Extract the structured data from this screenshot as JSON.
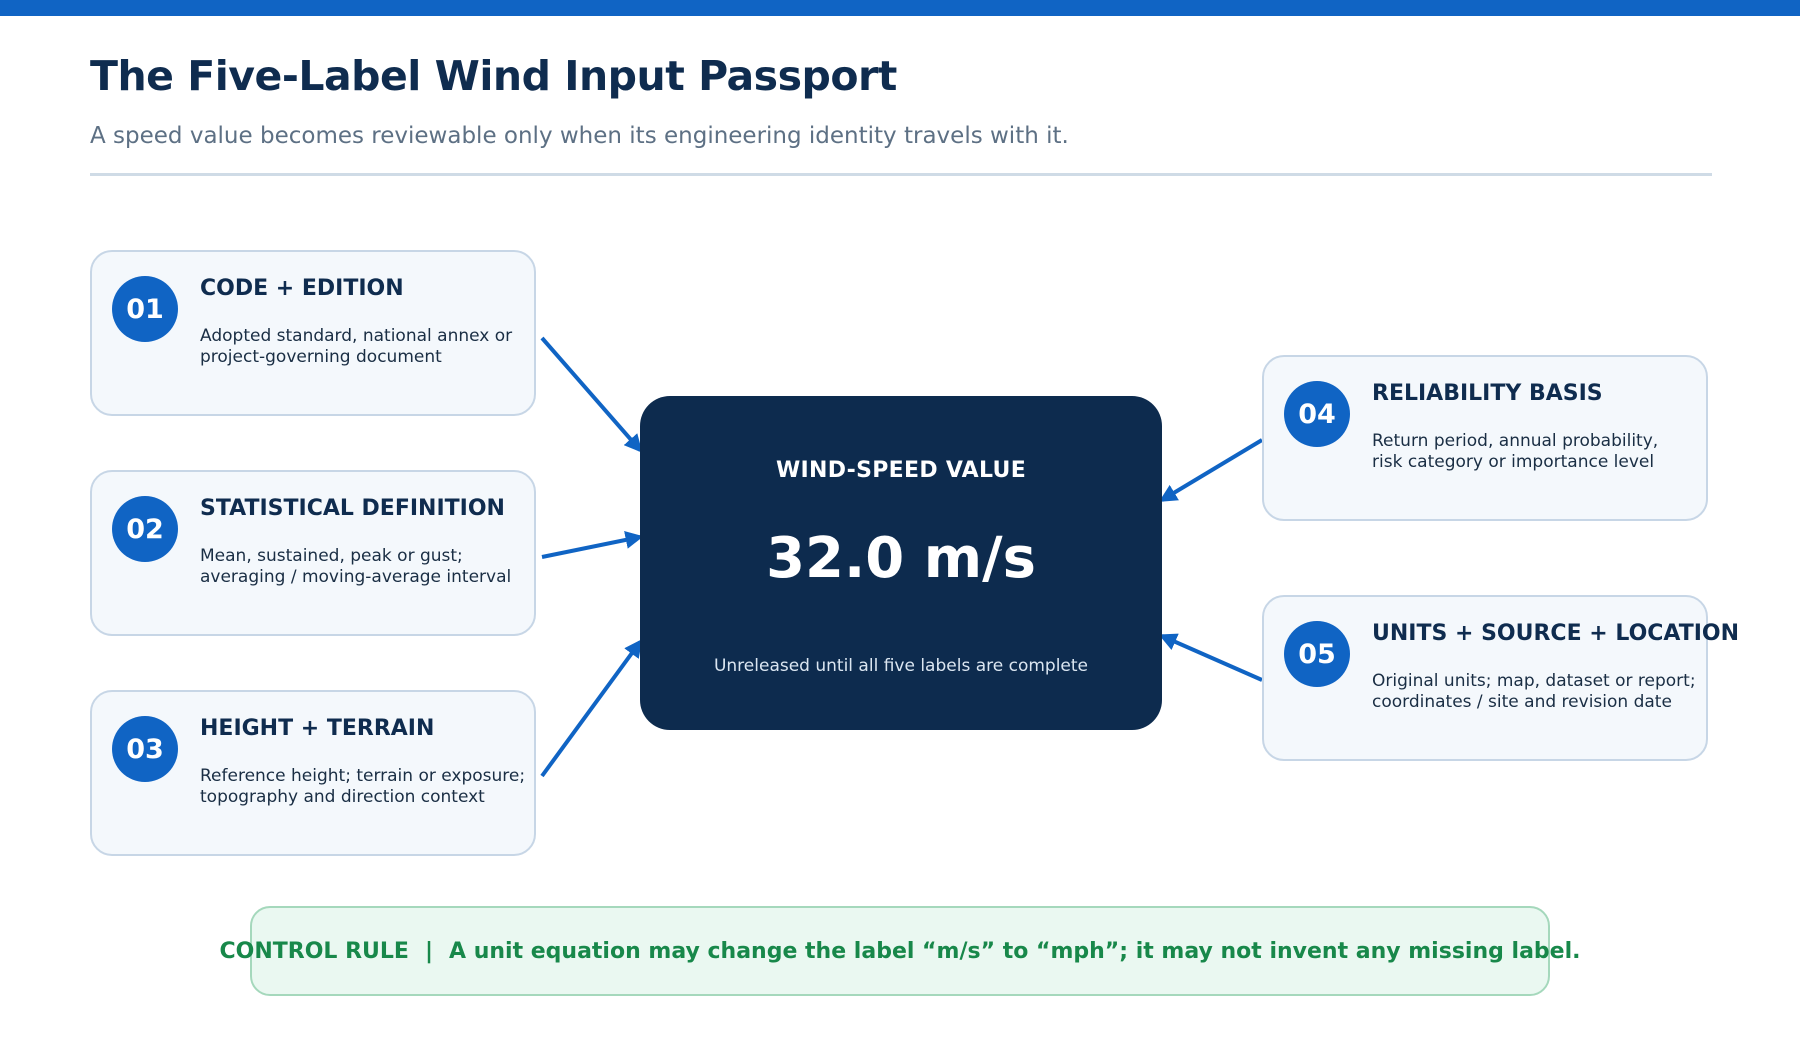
{
  "header": {
    "title": "The Five-Label Wind Input Passport",
    "subtitle": "A speed value becomes reviewable only when its engineering identity travels with it."
  },
  "labels": [
    {
      "num": "01",
      "title": "CODE + EDITION",
      "desc": "Adopted standard, national annex or\nproject-governing document"
    },
    {
      "num": "02",
      "title": "STATISTICAL DEFINITION",
      "desc": "Mean, sustained, peak or gust;\naveraging / moving-average interval"
    },
    {
      "num": "03",
      "title": "HEIGHT + TERRAIN",
      "desc": "Reference height; terrain or exposure;\ntopography and direction context"
    },
    {
      "num": "04",
      "title": "RELIABILITY BASIS",
      "desc": "Return period, annual probability,\nrisk category or importance level"
    },
    {
      "num": "05",
      "title": "UNITS + SOURCE + LOCATION",
      "desc": "Original units; map, dataset or report;\ncoordinates / site and revision date"
    }
  ],
  "center": {
    "label": "WIND-SPEED VALUE",
    "value": "32.0 m/s",
    "note": "Unreleased until all five labels are complete"
  },
  "rule": {
    "label": "CONTROL RULE",
    "separator": "|",
    "text": "A unit equation may change the label “m/s” to “mph”; it may not invent any missing label."
  },
  "colors": {
    "accent": "#1064c4",
    "navy": "#0d2b4e",
    "rule_green": "#18884a"
  }
}
